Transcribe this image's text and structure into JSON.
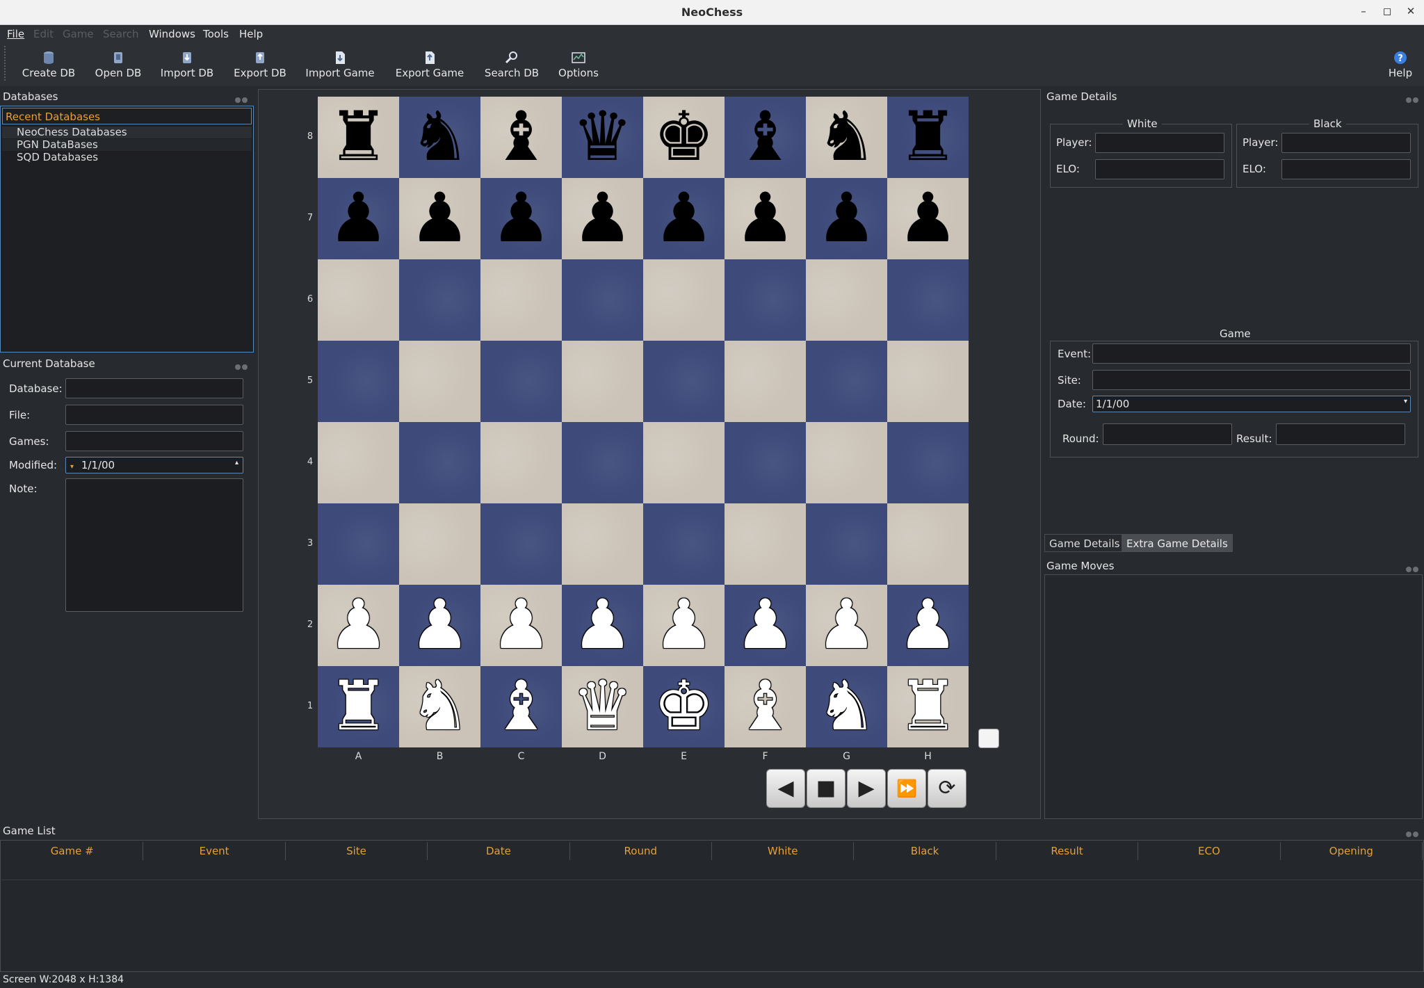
{
  "window": {
    "title": "NeoChess"
  },
  "menu": {
    "file": "File",
    "edit": "Edit",
    "game": "Game",
    "search": "Search",
    "windows": "Windows",
    "tools": "Tools",
    "help": "Help"
  },
  "toolbar": {
    "create_db": "Create DB",
    "open_db": "Open DB",
    "import_db": "Import DB",
    "export_db": "Export DB",
    "import_game": "Import Game",
    "export_game": "Export Game",
    "search_db": "Search DB",
    "options": "Options",
    "help": "Help"
  },
  "databases": {
    "title": "Databases",
    "recent_header": "Recent Databases",
    "items": [
      "NeoChess Databases",
      "PGN DataBases",
      "SQD Databases"
    ]
  },
  "current_db": {
    "title": "Current Database",
    "database_label": "Database:",
    "file_label": "File:",
    "games_label": "Games:",
    "modified_label": "Modified:",
    "modified_value": "1/1/00",
    "note_label": "Note:"
  },
  "board": {
    "ranks": [
      "8",
      "7",
      "6",
      "5",
      "4",
      "3",
      "2",
      "1"
    ],
    "files": [
      "A",
      "B",
      "C",
      "D",
      "E",
      "F",
      "G",
      "H"
    ],
    "position": [
      [
        "r",
        "n",
        "b",
        "q",
        "k",
        "b",
        "n",
        "r"
      ],
      [
        "p",
        "p",
        "p",
        "p",
        "p",
        "p",
        "p",
        "p"
      ],
      [
        "",
        "",
        "",
        "",
        "",
        "",
        "",
        ""
      ],
      [
        "",
        "",
        "",
        "",
        "",
        "",
        "",
        ""
      ],
      [
        "",
        "",
        "",
        "",
        "",
        "",
        "",
        ""
      ],
      [
        "",
        "",
        "",
        "",
        "",
        "",
        "",
        ""
      ],
      [
        "P",
        "P",
        "P",
        "P",
        "P",
        "P",
        "P",
        "P"
      ],
      [
        "R",
        "N",
        "B",
        "Q",
        "K",
        "B",
        "N",
        "R"
      ]
    ]
  },
  "game_details": {
    "title": "Game Details",
    "white_group": "White",
    "black_group": "Black",
    "player_label": "Player:",
    "elo_label": "ELO:",
    "game_group": "Game",
    "event_label": "Event:",
    "site_label": "Site:",
    "date_label": "Date:",
    "date_value": "1/1/00",
    "round_label": "Round:",
    "result_label": "Result:",
    "tabs": [
      "Game Details",
      "Extra Game Details"
    ]
  },
  "game_moves": {
    "title": "Game Moves"
  },
  "game_list": {
    "title": "Game List",
    "columns": [
      "Game #",
      "Event",
      "Site",
      "Date",
      "Round",
      "White",
      "Black",
      "Result",
      "ECO",
      "Opening"
    ]
  },
  "status": {
    "text": "Screen W:2048 x H:1384"
  },
  "colors": {
    "accent": "#e8a033",
    "board_light": "#cbc3b7",
    "board_dark": "#3d4a7a"
  }
}
